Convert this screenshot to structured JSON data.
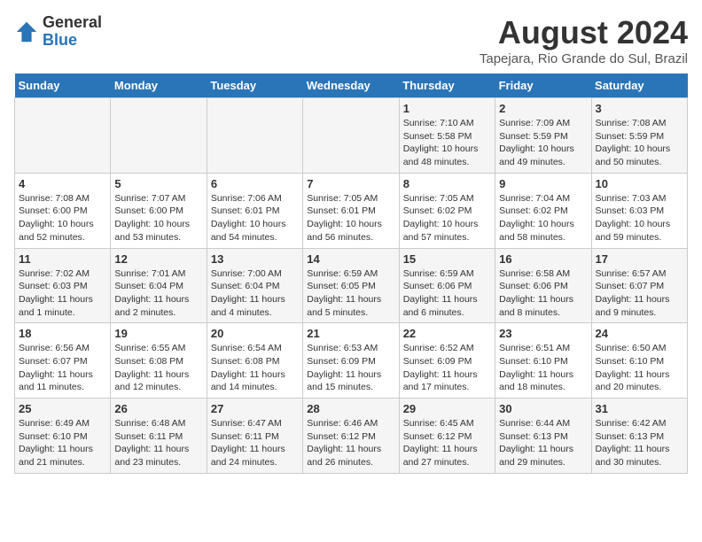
{
  "header": {
    "logo_general": "General",
    "logo_blue": "Blue",
    "month_title": "August 2024",
    "location": "Tapejara, Rio Grande do Sul, Brazil"
  },
  "days_of_week": [
    "Sunday",
    "Monday",
    "Tuesday",
    "Wednesday",
    "Thursday",
    "Friday",
    "Saturday"
  ],
  "weeks": [
    [
      {
        "day": "",
        "info": ""
      },
      {
        "day": "",
        "info": ""
      },
      {
        "day": "",
        "info": ""
      },
      {
        "day": "",
        "info": ""
      },
      {
        "day": "1",
        "info": "Sunrise: 7:10 AM\nSunset: 5:58 PM\nDaylight: 10 hours and 48 minutes."
      },
      {
        "day": "2",
        "info": "Sunrise: 7:09 AM\nSunset: 5:59 PM\nDaylight: 10 hours and 49 minutes."
      },
      {
        "day": "3",
        "info": "Sunrise: 7:08 AM\nSunset: 5:59 PM\nDaylight: 10 hours and 50 minutes."
      }
    ],
    [
      {
        "day": "4",
        "info": "Sunrise: 7:08 AM\nSunset: 6:00 PM\nDaylight: 10 hours and 52 minutes."
      },
      {
        "day": "5",
        "info": "Sunrise: 7:07 AM\nSunset: 6:00 PM\nDaylight: 10 hours and 53 minutes."
      },
      {
        "day": "6",
        "info": "Sunrise: 7:06 AM\nSunset: 6:01 PM\nDaylight: 10 hours and 54 minutes."
      },
      {
        "day": "7",
        "info": "Sunrise: 7:05 AM\nSunset: 6:01 PM\nDaylight: 10 hours and 56 minutes."
      },
      {
        "day": "8",
        "info": "Sunrise: 7:05 AM\nSunset: 6:02 PM\nDaylight: 10 hours and 57 minutes."
      },
      {
        "day": "9",
        "info": "Sunrise: 7:04 AM\nSunset: 6:02 PM\nDaylight: 10 hours and 58 minutes."
      },
      {
        "day": "10",
        "info": "Sunrise: 7:03 AM\nSunset: 6:03 PM\nDaylight: 10 hours and 59 minutes."
      }
    ],
    [
      {
        "day": "11",
        "info": "Sunrise: 7:02 AM\nSunset: 6:03 PM\nDaylight: 11 hours and 1 minute."
      },
      {
        "day": "12",
        "info": "Sunrise: 7:01 AM\nSunset: 6:04 PM\nDaylight: 11 hours and 2 minutes."
      },
      {
        "day": "13",
        "info": "Sunrise: 7:00 AM\nSunset: 6:04 PM\nDaylight: 11 hours and 4 minutes."
      },
      {
        "day": "14",
        "info": "Sunrise: 6:59 AM\nSunset: 6:05 PM\nDaylight: 11 hours and 5 minutes."
      },
      {
        "day": "15",
        "info": "Sunrise: 6:59 AM\nSunset: 6:06 PM\nDaylight: 11 hours and 6 minutes."
      },
      {
        "day": "16",
        "info": "Sunrise: 6:58 AM\nSunset: 6:06 PM\nDaylight: 11 hours and 8 minutes."
      },
      {
        "day": "17",
        "info": "Sunrise: 6:57 AM\nSunset: 6:07 PM\nDaylight: 11 hours and 9 minutes."
      }
    ],
    [
      {
        "day": "18",
        "info": "Sunrise: 6:56 AM\nSunset: 6:07 PM\nDaylight: 11 hours and 11 minutes."
      },
      {
        "day": "19",
        "info": "Sunrise: 6:55 AM\nSunset: 6:08 PM\nDaylight: 11 hours and 12 minutes."
      },
      {
        "day": "20",
        "info": "Sunrise: 6:54 AM\nSunset: 6:08 PM\nDaylight: 11 hours and 14 minutes."
      },
      {
        "day": "21",
        "info": "Sunrise: 6:53 AM\nSunset: 6:09 PM\nDaylight: 11 hours and 15 minutes."
      },
      {
        "day": "22",
        "info": "Sunrise: 6:52 AM\nSunset: 6:09 PM\nDaylight: 11 hours and 17 minutes."
      },
      {
        "day": "23",
        "info": "Sunrise: 6:51 AM\nSunset: 6:10 PM\nDaylight: 11 hours and 18 minutes."
      },
      {
        "day": "24",
        "info": "Sunrise: 6:50 AM\nSunset: 6:10 PM\nDaylight: 11 hours and 20 minutes."
      }
    ],
    [
      {
        "day": "25",
        "info": "Sunrise: 6:49 AM\nSunset: 6:10 PM\nDaylight: 11 hours and 21 minutes."
      },
      {
        "day": "26",
        "info": "Sunrise: 6:48 AM\nSunset: 6:11 PM\nDaylight: 11 hours and 23 minutes."
      },
      {
        "day": "27",
        "info": "Sunrise: 6:47 AM\nSunset: 6:11 PM\nDaylight: 11 hours and 24 minutes."
      },
      {
        "day": "28",
        "info": "Sunrise: 6:46 AM\nSunset: 6:12 PM\nDaylight: 11 hours and 26 minutes."
      },
      {
        "day": "29",
        "info": "Sunrise: 6:45 AM\nSunset: 6:12 PM\nDaylight: 11 hours and 27 minutes."
      },
      {
        "day": "30",
        "info": "Sunrise: 6:44 AM\nSunset: 6:13 PM\nDaylight: 11 hours and 29 minutes."
      },
      {
        "day": "31",
        "info": "Sunrise: 6:42 AM\nSunset: 6:13 PM\nDaylight: 11 hours and 30 minutes."
      }
    ]
  ]
}
